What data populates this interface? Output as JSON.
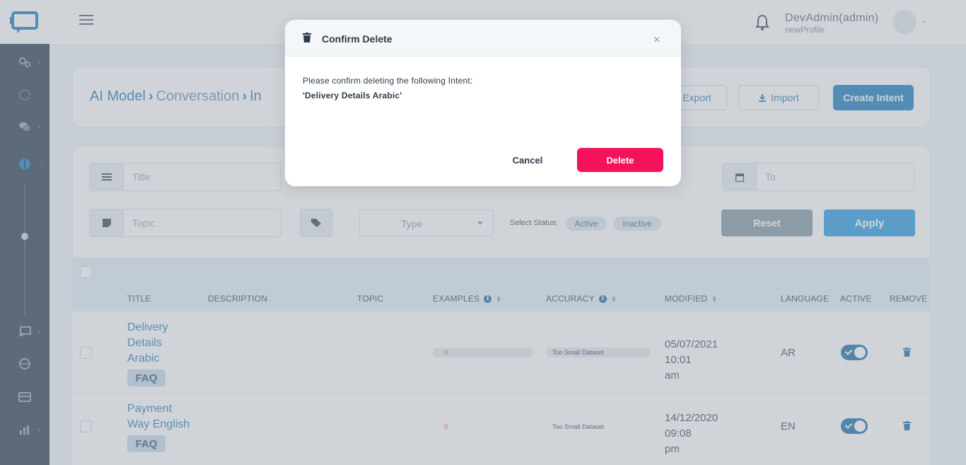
{
  "topbar": {
    "user_name": "DevAdmin(admin)",
    "user_profile": "newProfile"
  },
  "breadcrumb": {
    "items": [
      "AI Model",
      "Conversation",
      "In"
    ]
  },
  "header_actions": {
    "export_label": "Export",
    "import_label": "Import",
    "create_label": "Create Intent"
  },
  "filters": {
    "title_placeholder": "Title",
    "to_placeholder": "To",
    "topic_placeholder": "Topic",
    "type_value": "Type",
    "status_label": "Select Status:",
    "status_options": [
      "Active",
      "Inactive"
    ],
    "reset_label": "Reset",
    "apply_label": "Apply"
  },
  "table": {
    "columns": {
      "title": "TITLE",
      "description": "DESCRIPTION",
      "topic": "TOPIC",
      "examples": "EXAMPLES",
      "accuracy": "ACCURACY",
      "modified": "MODIFIED",
      "language": "LANGUAGE",
      "active": "ACTIVE",
      "remove": "REMOVE"
    },
    "rows": [
      {
        "title_lines": [
          "Delivery",
          "Details",
          "Arabic"
        ],
        "tag": "FAQ",
        "examples": "0",
        "accuracy": "Too Small Dataset",
        "modified_lines": [
          "05/07/2021 10:01",
          "am"
        ],
        "language": "AR",
        "active": true
      },
      {
        "title_lines": [
          "Payment",
          "Way English"
        ],
        "tag": "FAQ",
        "examples": "0",
        "accuracy": "Too Small Dataset",
        "modified_lines": [
          "14/12/2020 09:08",
          "pm"
        ],
        "language": "EN",
        "active": true
      }
    ]
  },
  "modal": {
    "title": "Confirm Delete",
    "close": "×",
    "message": "Please confirm deleting the following Intent:",
    "item": "'Delivery Details Arabic'",
    "cancel_label": "Cancel",
    "delete_label": "Delete"
  },
  "colors": {
    "sidebar": "#2d3e50",
    "primary": "#1c7cbd",
    "danger": "#f4125a",
    "accent_red_value": "#e3342f"
  }
}
